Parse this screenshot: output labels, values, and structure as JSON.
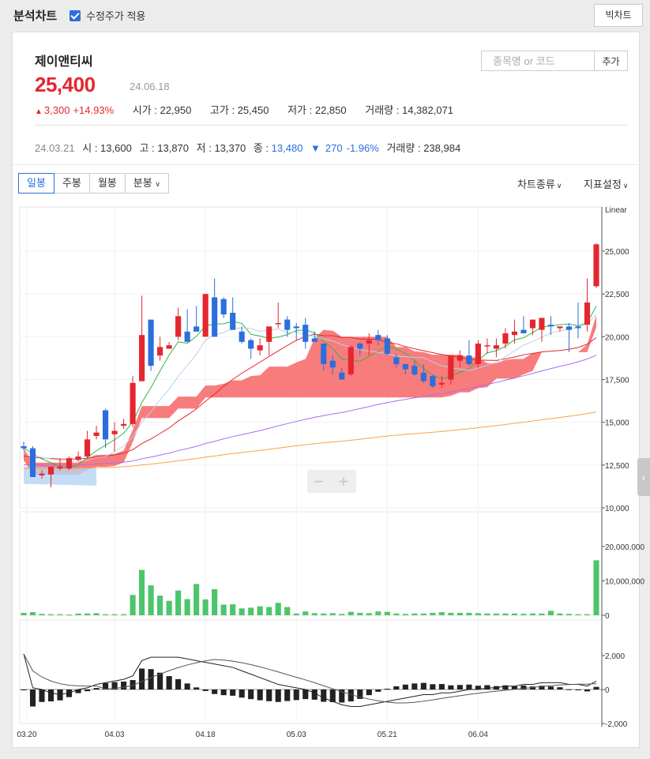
{
  "header": {
    "title": "분석차트",
    "adjusted_label": "수정주가 적용",
    "adjusted_checked": true,
    "big_chart_label": "빅차트"
  },
  "stock": {
    "name": "제이앤티씨",
    "price": "25,400",
    "date": "24.06.18",
    "change": "3,300",
    "change_pct": "+14.93%",
    "open_label": "시가",
    "open": "22,950",
    "high_label": "고가",
    "high": "25,450",
    "low_label": "저가",
    "low": "22,850",
    "volume_label": "거래량",
    "volume": "14,382,071"
  },
  "search": {
    "placeholder": "종목명 or 코드",
    "add_label": "추가"
  },
  "hover": {
    "date": "24.03.21",
    "open_label": "시",
    "open": "13,600",
    "high_label": "고",
    "high": "13,870",
    "low_label": "저",
    "low": "13,370",
    "close_label": "종",
    "close": "13,480",
    "change": "270",
    "change_pct": "-1.96%",
    "volume_label": "거래량",
    "volume": "238,984"
  },
  "tabs": [
    {
      "label": "일봉",
      "active": true
    },
    {
      "label": "주봉",
      "active": false
    },
    {
      "label": "월봉",
      "active": false
    },
    {
      "label": "분봉",
      "active": false
    }
  ],
  "menu": {
    "chart_type": "차트종류",
    "indicator": "지표설정"
  },
  "colors": {
    "up": "#e5262f",
    "down": "#2a6fdb",
    "volume": "#4cc56b",
    "cloud_bull": "#f76e6e",
    "cloud_bear": "#b5d3f2"
  },
  "chart_data": {
    "type": "candlestick",
    "scale_label": "Linear",
    "price_ticks": [
      "25,000",
      "22,500",
      "20,000",
      "17,500",
      "15,000",
      "12,500",
      "10,000"
    ],
    "price_tick_values": [
      25000,
      22500,
      20000,
      17500,
      15000,
      12500,
      10000
    ],
    "volume_ticks": [
      "20,000,000",
      "10,000,000",
      "0"
    ],
    "volume_tick_values": [
      20000000,
      10000000,
      0
    ],
    "macd_ticks": [
      "2,000",
      "0",
      "-2,000"
    ],
    "macd_tick_values": [
      2000,
      0,
      -2000
    ],
    "x_labels": [
      "03.20",
      "04.03",
      "04.18",
      "05.03",
      "05.21",
      "06.04"
    ],
    "x_label_index": [
      0,
      10,
      20,
      30,
      40,
      50
    ],
    "candles": [
      [
        13600,
        13870,
        13370,
        13480
      ],
      [
        13480,
        13600,
        11800,
        11800
      ],
      [
        11900,
        12200,
        11700,
        12000
      ],
      [
        11950,
        12300,
        11200,
        12400
      ],
      [
        12300,
        12900,
        12200,
        12400
      ],
      [
        12300,
        13000,
        12200,
        12900
      ],
      [
        12800,
        13300,
        12700,
        13000
      ],
      [
        13000,
        14500,
        12900,
        14000
      ],
      [
        14200,
        14800,
        14000,
        14400
      ],
      [
        15700,
        15800,
        13500,
        14000
      ],
      [
        14300,
        15000,
        13300,
        14500
      ],
      [
        14800,
        15200,
        14600,
        14900
      ],
      [
        14900,
        17700,
        14700,
        17300
      ],
      [
        17400,
        22400,
        17400,
        20100
      ],
      [
        21000,
        21000,
        18000,
        18300
      ],
      [
        18900,
        20000,
        18600,
        19400
      ],
      [
        19300,
        19700,
        19300,
        19500
      ],
      [
        20000,
        21700,
        19800,
        21200
      ],
      [
        20300,
        21600,
        20000,
        19700
      ],
      [
        20600,
        21800,
        20600,
        20300
      ],
      [
        20000,
        22100,
        20000,
        22500
      ],
      [
        22300,
        23400,
        20000,
        20000
      ],
      [
        22200,
        22300,
        21100,
        21300
      ],
      [
        21400,
        22300,
        20400,
        20400
      ],
      [
        20300,
        20600,
        19600,
        19700
      ],
      [
        19800,
        19900,
        18700,
        19300
      ],
      [
        19200,
        19900,
        18900,
        19500
      ],
      [
        19700,
        20100,
        18900,
        20600
      ],
      [
        20800,
        22000,
        20500,
        20800
      ],
      [
        21000,
        21200,
        20000,
        20400
      ],
      [
        20600,
        20800,
        19800,
        20500
      ],
      [
        20700,
        21100,
        19300,
        19700
      ],
      [
        19900,
        20300,
        19700,
        19700
      ],
      [
        19600,
        19600,
        18000,
        18400
      ],
      [
        18600,
        18900,
        17800,
        18200
      ],
      [
        17900,
        18200,
        17600,
        17500
      ],
      [
        17800,
        19500,
        17700,
        19400
      ],
      [
        19600,
        19700,
        18900,
        19300
      ],
      [
        19600,
        20200,
        18900,
        19800
      ],
      [
        20100,
        20400,
        19500,
        19800
      ],
      [
        19900,
        20100,
        18900,
        19000
      ],
      [
        18800,
        19000,
        18200,
        18400
      ],
      [
        18400,
        18400,
        17800,
        18100
      ],
      [
        18300,
        18600,
        17700,
        17800
      ],
      [
        17900,
        18400,
        17300,
        17400
      ],
      [
        17700,
        17800,
        17000,
        17100
      ],
      [
        17200,
        17700,
        17000,
        17300
      ],
      [
        17500,
        18800,
        17200,
        18900
      ],
      [
        18600,
        19200,
        18200,
        18900
      ],
      [
        18900,
        19800,
        18300,
        18400
      ],
      [
        18400,
        19800,
        18200,
        19600
      ],
      [
        19500,
        19900,
        19000,
        19500
      ],
      [
        19300,
        19900,
        18800,
        19500
      ],
      [
        19600,
        20500,
        19300,
        20200
      ],
      [
        20100,
        21000,
        19600,
        20300
      ],
      [
        20400,
        21200,
        20200,
        20200
      ],
      [
        20500,
        21000,
        20100,
        21000
      ],
      [
        20400,
        21100,
        19700,
        21100
      ],
      [
        20700,
        21200,
        20100,
        20600
      ],
      [
        20500,
        20600,
        20300,
        20600
      ],
      [
        20600,
        20800,
        19100,
        20400
      ],
      [
        20600,
        22000,
        19900,
        20500
      ],
      [
        20700,
        23400,
        20300,
        22000
      ],
      [
        22950,
        25450,
        22850,
        25400
      ]
    ],
    "volume": [
      0.7,
      0.9,
      0.4,
      0.3,
      0.3,
      0.2,
      0.5,
      0.5,
      0.6,
      0.3,
      0.3,
      0.3,
      5.9,
      13.2,
      8.7,
      5.7,
      4.2,
      7.2,
      4.7,
      9.1,
      4.6,
      7.6,
      3.1,
      3.2,
      2.0,
      2.2,
      2.6,
      2.4,
      3.6,
      2.4,
      0.5,
      1.1,
      0.6,
      0.5,
      0.6,
      0.4,
      1.0,
      0.7,
      0.6,
      1.1,
      1.0,
      0.5,
      0.4,
      0.5,
      0.5,
      0.7,
      0.9,
      0.7,
      0.7,
      0.7,
      0.6,
      0.5,
      0.5,
      0.5,
      0.5,
      0.4,
      0.5,
      0.5,
      1.3,
      0.5,
      0.4,
      0.3,
      0.3,
      16.0
    ],
    "volume_scale": 1000000,
    "macd": [
      2100,
      100,
      0,
      -200,
      -300,
      -200,
      0,
      100,
      300,
      400,
      500,
      600,
      800,
      1700,
      1900,
      1900,
      1900,
      1900,
      1800,
      1700,
      1600,
      1500,
      1400,
      1300,
      1100,
      900,
      700,
      500,
      300,
      200,
      100,
      0,
      -200,
      -500,
      -700,
      -900,
      -1000,
      -1000,
      -900,
      -800,
      -700,
      -600,
      -500,
      -400,
      -300,
      -300,
      -200,
      -200,
      -100,
      0,
      0,
      100,
      100,
      200,
      200,
      300,
      300,
      400,
      400,
      400,
      300,
      300,
      200,
      500
    ],
    "ma_legend": []
  }
}
